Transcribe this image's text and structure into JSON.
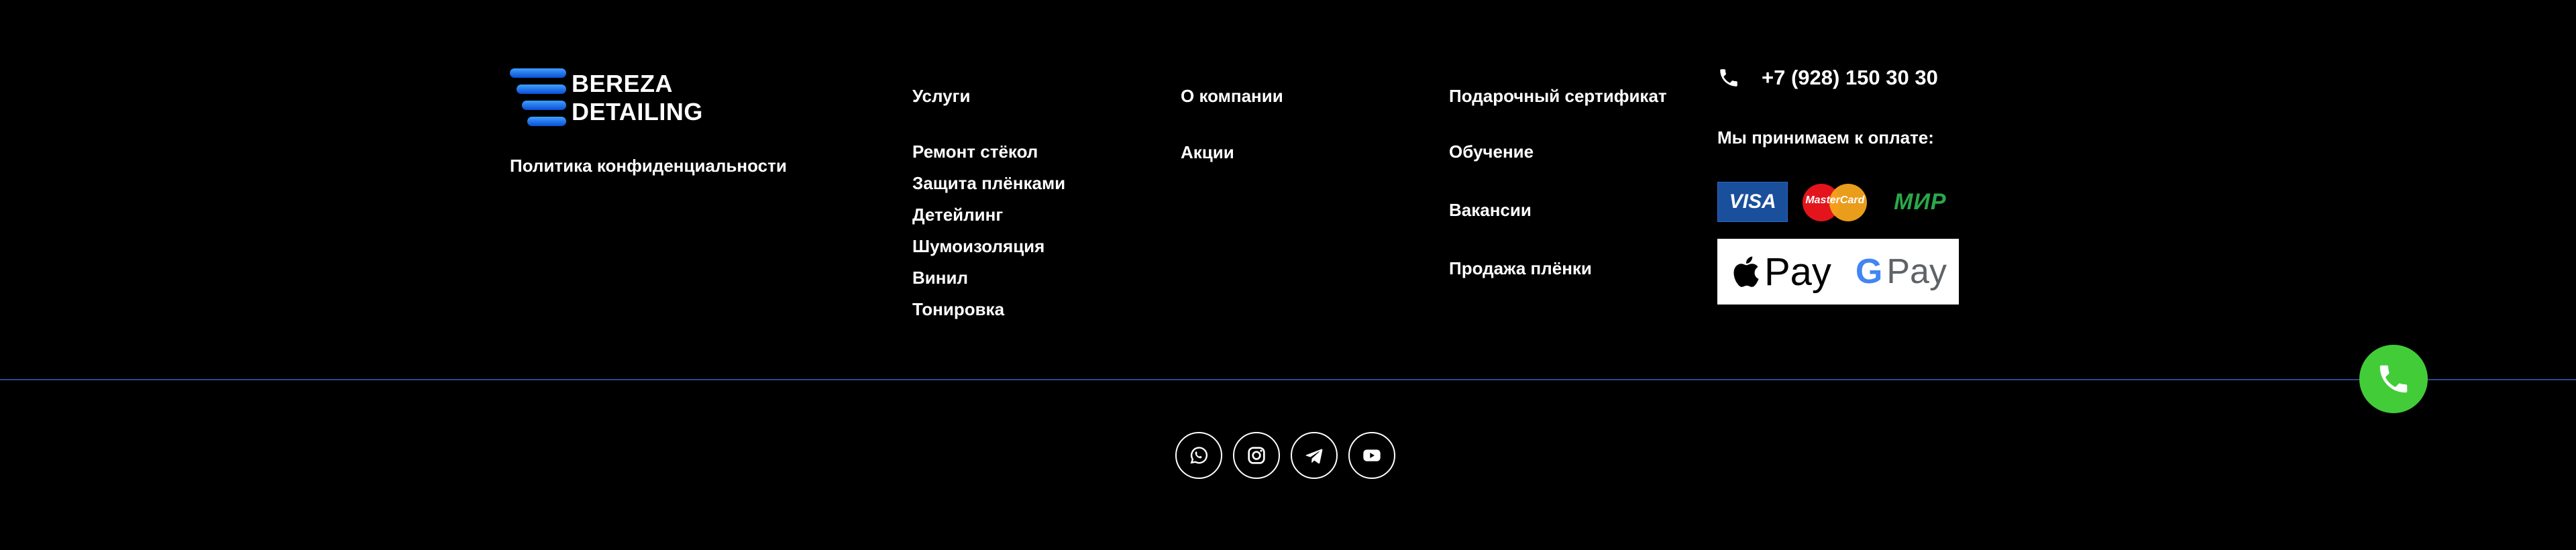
{
  "brand": {
    "line1": "BEREZA",
    "line2": "DETAILING",
    "accent": "#1e7bff"
  },
  "policy_link": "Политика конфиденциальности",
  "columns": {
    "services": {
      "title": "Услуги",
      "items": [
        "Ремонт стёкол",
        "Защита плёнками",
        "Детейлинг",
        "Шумоизоляция",
        "Винил",
        "Тонировка"
      ]
    },
    "about": {
      "title": "О компании",
      "items": [
        "Акции"
      ]
    },
    "gift": {
      "title": "Подарочный сертификат",
      "items": [
        "Обучение",
        "Вакансии",
        "Продажа плёнки"
      ]
    }
  },
  "contact": {
    "phone": "+7 (928) 150 30 30",
    "phone_icon": "phone-icon"
  },
  "payment": {
    "title": "Мы принимаем к оплате:",
    "cards": {
      "visa": "VISA",
      "mastercard": "MasterCard",
      "mir": "МИР"
    },
    "apple_pay": "Pay",
    "google_pay": "Pay",
    "google_letter": "G"
  },
  "call_button": {
    "icon": "phone-icon",
    "color": "#42cd38"
  },
  "socials": [
    {
      "icon": "whatsapp-icon"
    },
    {
      "icon": "instagram-icon"
    },
    {
      "icon": "telegram-icon"
    },
    {
      "icon": "youtube-icon"
    }
  ],
  "colors": {
    "background": "#000000",
    "divider": "#294a8c"
  }
}
